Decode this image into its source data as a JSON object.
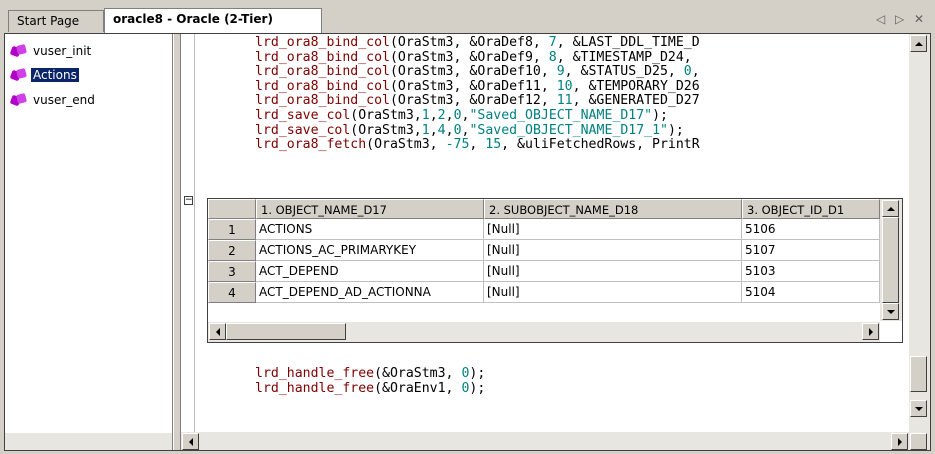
{
  "tabs": {
    "start": "Start Page",
    "active": "oracle8 - Oracle (2-Tier)",
    "controls": {
      "left": "◁",
      "right": "▷",
      "close": "✕"
    }
  },
  "tree": {
    "items": [
      {
        "label": "vuser_init",
        "icon": "action-icon",
        "selected": false
      },
      {
        "label": "Actions",
        "icon": "action-icon",
        "selected": true
      },
      {
        "label": "vuser_end",
        "icon": "action-icon",
        "selected": false
      }
    ]
  },
  "code": {
    "top_lines": [
      "lrd_ora8_bind_col(OraStm3, &OraDef8, 7, &LAST_DDL_TIME_D",
      "lrd_ora8_bind_col(OraStm3, &OraDef9, 8, &TIMESTAMP_D24,",
      "lrd_ora8_bind_col(OraStm3, &OraDef10, 9, &STATUS_D25, 0,",
      "lrd_ora8_bind_col(OraStm3, &OraDef11, 10, &TEMPORARY_D26",
      "lrd_ora8_bind_col(OraStm3, &OraDef12, 11, &GENERATED_D27",
      "lrd_save_col(OraStm3,1,2,0,\"Saved_OBJECT_NAME_D17\");",
      "lrd_save_col(OraStm3,1,4,0,\"Saved_OBJECT_NAME_D17_1\");",
      "lrd_ora8_fetch(OraStm3, -75, 15, &uliFetchedRows, PrintR"
    ],
    "bottom_lines": [
      "lrd_handle_free(&OraStm3, 0);",
      "lrd_handle_free(&OraEnv1, 0);"
    ],
    "fold_symbol": "−"
  },
  "grid": {
    "columns": [
      "1. OBJECT_NAME_D17",
      "2. SUBOBJECT_NAME_D18",
      "3. OBJECT_ID_D1"
    ],
    "rows": [
      {
        "num": "1",
        "cells": [
          "ACTIONS",
          "[Null]",
          "5106"
        ]
      },
      {
        "num": "2",
        "cells": [
          "ACTIONS_AC_PRIMARYKEY",
          "[Null]",
          "5107"
        ]
      },
      {
        "num": "3",
        "cells": [
          "ACT_DEPEND",
          "[Null]",
          "5103"
        ]
      },
      {
        "num": "4",
        "cells": [
          "ACT_DEPEND_AD_ACTIONNA",
          "[Null]",
          "5104"
        ]
      }
    ]
  },
  "colors": {
    "function": "#800000",
    "literal": "#008080",
    "selection": "#0a246a",
    "chrome": "#d4d0c8"
  }
}
